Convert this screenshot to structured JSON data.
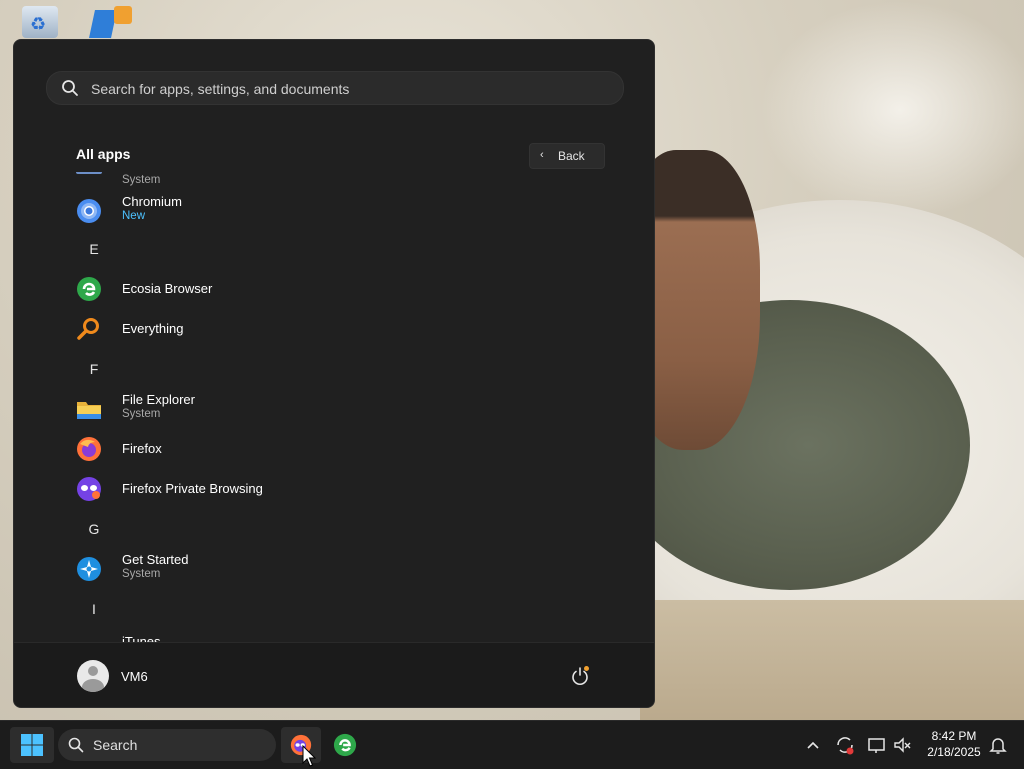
{
  "start_menu": {
    "search_placeholder": "Search for apps, settings, and documents",
    "all_apps_title": "All apps",
    "back_label": "Back",
    "apps": {
      "partial_top_sub": "System",
      "chromium": {
        "name": "Chromium",
        "sub": "New"
      },
      "letter_e": "E",
      "ecosia": {
        "name": "Ecosia Browser"
      },
      "everything": {
        "name": "Everything"
      },
      "letter_f": "F",
      "file_explorer": {
        "name": "File Explorer",
        "sub": "System"
      },
      "firefox": {
        "name": "Firefox"
      },
      "firefox_private": {
        "name": "Firefox Private Browsing"
      },
      "letter_g": "G",
      "get_started": {
        "name": "Get Started",
        "sub": "System"
      },
      "letter_i": "I",
      "itunes": {
        "name": "iTunes"
      }
    },
    "user_name": "VM6"
  },
  "taskbar": {
    "search_label": "Search",
    "time": "8:42 PM",
    "date": "2/18/2025"
  },
  "colors": {
    "menu_bg": "#202020",
    "accent_new": "#4cc2ff",
    "windows_logo": "#4cc2ff"
  },
  "icons": [
    "recycle-bin-icon",
    "search-icon",
    "chevron-left-icon",
    "chromium-icon",
    "ecosia-icon",
    "everything-icon",
    "folder-icon",
    "firefox-icon",
    "firefox-private-icon",
    "get-started-icon",
    "power-icon",
    "windows-logo-icon",
    "chevron-up-icon",
    "bell-icon"
  ]
}
